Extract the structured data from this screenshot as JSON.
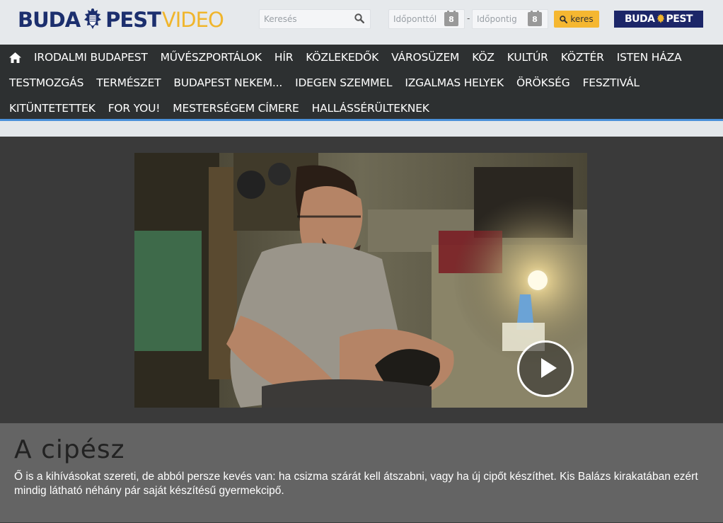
{
  "header": {
    "logo": {
      "part1": "BUDA",
      "part2": "PEST",
      "part3": "VIDEO"
    },
    "search": {
      "placeholder": "Keresés",
      "icon": "search-icon"
    },
    "date_from": {
      "placeholder": "Időponttól",
      "icon_text": "8"
    },
    "date_separator": "-",
    "date_to": {
      "placeholder": "Időpontig",
      "icon_text": "8"
    },
    "search_button": "keres",
    "badge": {
      "part1": "BUDA",
      "part2": "PEST"
    }
  },
  "nav": {
    "home_icon": "home-icon",
    "items": [
      "IRODALMI BUDAPEST",
      "MŰVÉSZPORTÁLOK",
      "HÍR",
      "KÖZLEKEDŐK",
      "VÁROSÜZEM",
      "KÖZ",
      "KULTÚR",
      "KÖZTÉR",
      "ISTEN HÁZA",
      "TESTMOZGÁS",
      "TERMÉSZET",
      "BUDAPEST NEKEM...",
      "IDEGEN SZEMMEL",
      "IZGALMAS HELYEK",
      "ÖRÖKSÉG",
      "FESZTIVÁL",
      "KITÜNTETETTEK",
      "FOR YOU!",
      "MESTERSÉGEM CÍMERE",
      "HALLÁSSÉRÜLTEKNEK"
    ]
  },
  "video": {
    "play_icon": "play-icon"
  },
  "article": {
    "title": "A cipész",
    "description": "Ő is a kihívásokat szereti, de abból persze kevés van: ha csizma szárát kell átszabni, vagy ha új cipőt készíthet. Kis Balázs kirakatában ezért mindig látható néhány pár saját készítésű gyermekcipő."
  },
  "colors": {
    "brand_blue": "#1c2f6e",
    "brand_yellow": "#f0b52c",
    "nav_bg": "#2d3031",
    "nav_accent": "#4a90d9"
  }
}
